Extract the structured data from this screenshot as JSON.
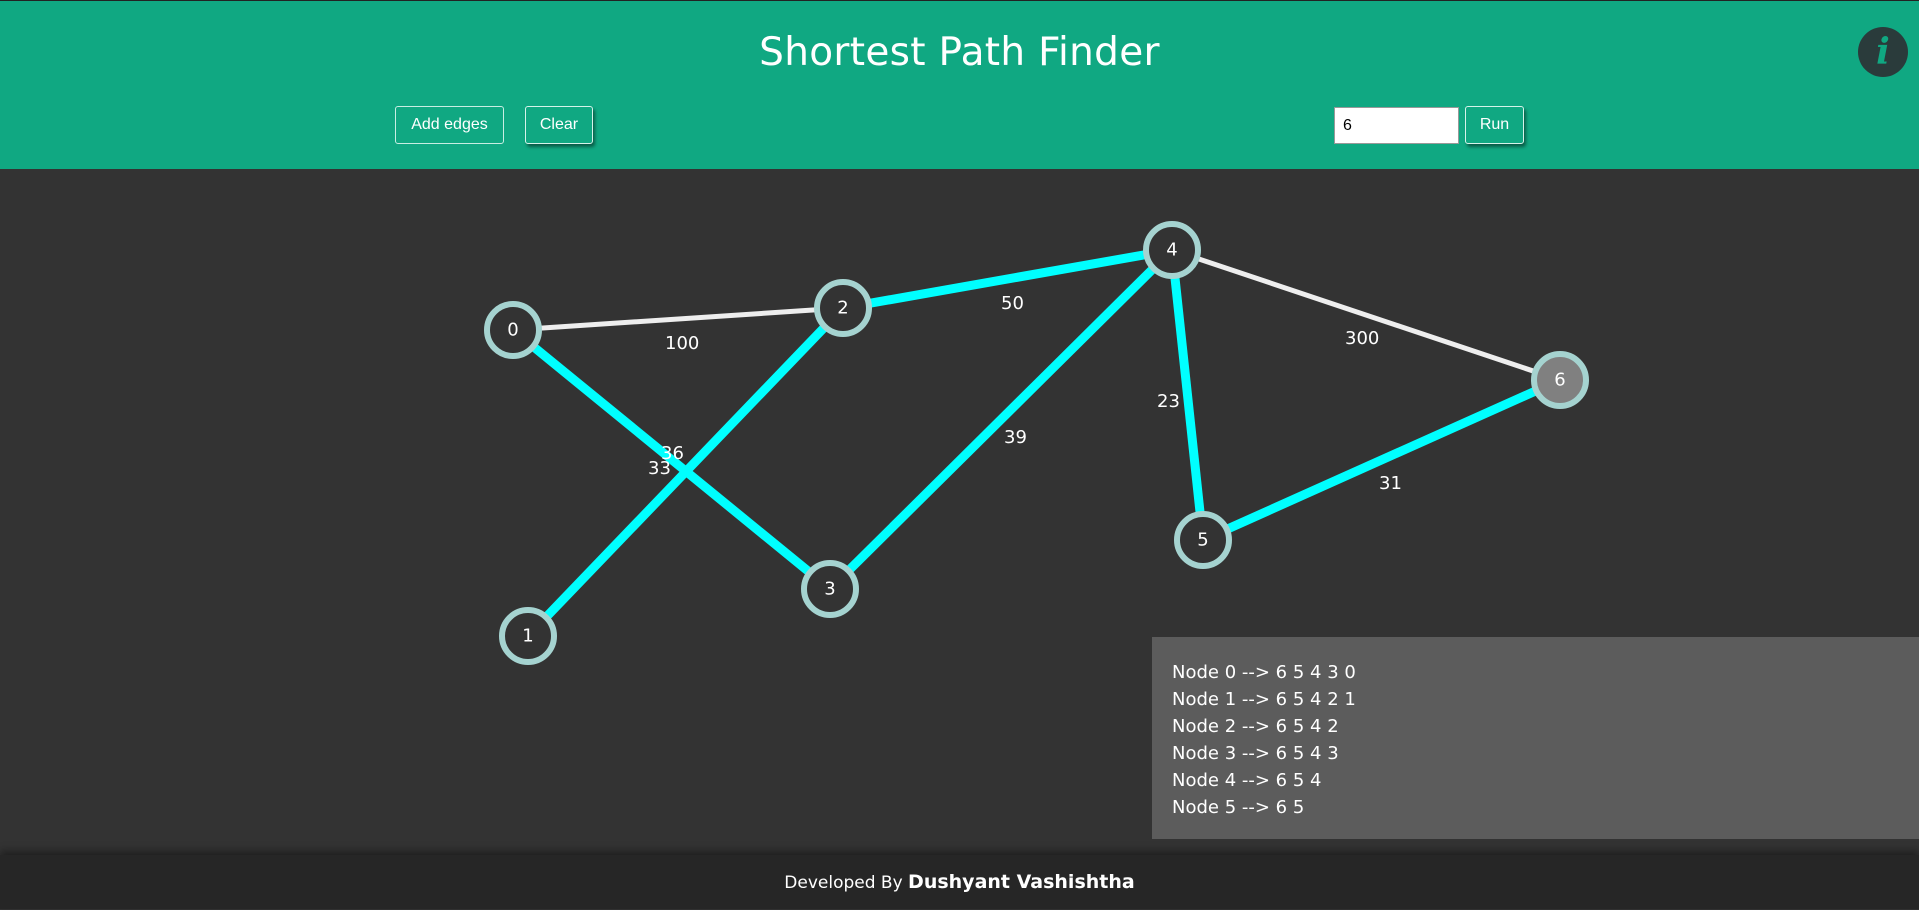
{
  "header": {
    "title": "Shortest Path Finder",
    "info_icon": "info-icon",
    "add_edges_label": "Add edges",
    "clear_label": "Clear",
    "start_node_value": "6",
    "run_label": "Run"
  },
  "colors": {
    "header_bg": "#10a882",
    "canvas_bg": "#333333",
    "path_edge": "#00ffff",
    "normal_edge": "#eeeeee",
    "node_ring": "#a5d3d0",
    "source_node_fill": "#808080",
    "result_panel_bg": "#5c5c5c",
    "footer_bg": "#262626"
  },
  "graph": {
    "source": "6",
    "nodes": [
      "0",
      "1",
      "2",
      "3",
      "4",
      "5",
      "6"
    ],
    "edges": [
      {
        "from": "0",
        "to": "2",
        "weight": "100",
        "on_path": false
      },
      {
        "from": "0",
        "to": "3",
        "weight": "36",
        "on_path": true
      },
      {
        "from": "1",
        "to": "2",
        "weight": "33",
        "on_path": true
      },
      {
        "from": "2",
        "to": "4",
        "weight": "50",
        "on_path": true
      },
      {
        "from": "3",
        "to": "4",
        "weight": "39",
        "on_path": true
      },
      {
        "from": "4",
        "to": "5",
        "weight": "23",
        "on_path": true
      },
      {
        "from": "4",
        "to": "6",
        "weight": "300",
        "on_path": false
      },
      {
        "from": "5",
        "to": "6",
        "weight": "31",
        "on_path": true
      }
    ]
  },
  "results": [
    "Node 0 --> 6 5 4 3 0",
    "Node 1 --> 6 5 4 2 1",
    "Node 2 --> 6 5 4 2",
    "Node 3 --> 6 5 4 3",
    "Node 4 --> 6 5 4",
    "Node 5 --> 6 5"
  ],
  "footer": {
    "prefix": "Developed By ",
    "author": "Dushyant Vashishtha"
  }
}
